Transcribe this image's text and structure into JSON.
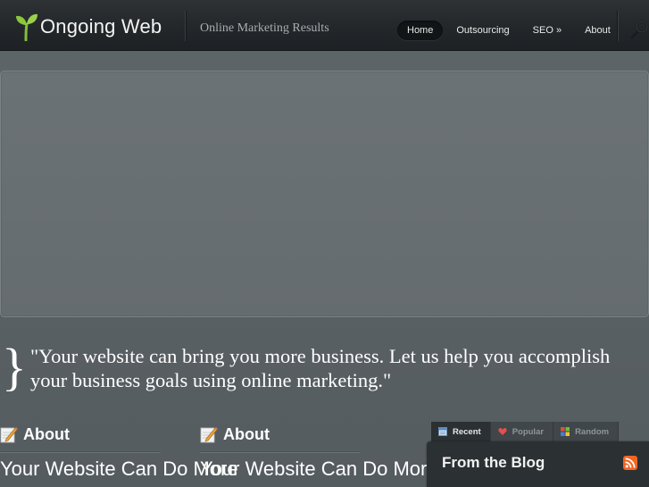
{
  "header": {
    "logo_text": "Ongoing Web",
    "tagline": "Online Marketing Results",
    "nav": [
      {
        "label": "Home",
        "active": true
      },
      {
        "label": "Outsourcing",
        "active": false
      },
      {
        "label": "SEO »",
        "active": false
      },
      {
        "label": "About",
        "active": false
      }
    ]
  },
  "quote": {
    "brace": "}",
    "text": "\"Your website can bring you more business. Let us help you accomplish your business goals using online marketing.\""
  },
  "columns": [
    {
      "title": "About",
      "subtitle": "Your Website Can Do More",
      "icon": "pencil-icon"
    },
    {
      "title": "About",
      "subtitle": "Your Website Can Do More",
      "icon": "pencil-icon"
    }
  ],
  "blog": {
    "tabs": [
      {
        "label": "Recent",
        "icon": "recent-icon",
        "active": true
      },
      {
        "label": "Popular",
        "icon": "heart-icon",
        "active": false
      },
      {
        "label": "Random",
        "icon": "random-icon",
        "active": false
      }
    ],
    "title": "From the Blog",
    "rss_icon": "rss-icon"
  },
  "colors": {
    "background": "#5b6266",
    "header": "#23272a",
    "accent_green": "#8cc63f",
    "rss_orange": "#f26522"
  }
}
